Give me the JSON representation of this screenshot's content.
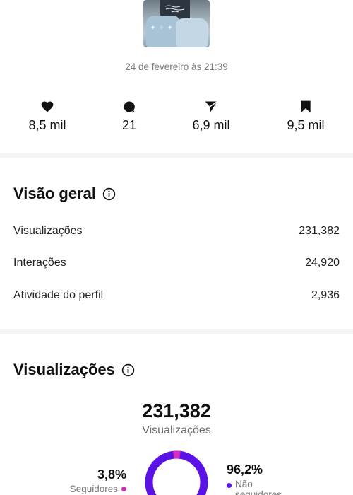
{
  "post": {
    "date": "24 de fevereiro às 21:39"
  },
  "stats": {
    "likes": "8,5 mil",
    "comments": "21",
    "shares": "6,9 mil",
    "saves": "9,5 mil"
  },
  "overview": {
    "title": "Visão geral",
    "rows": [
      {
        "label": "Visualizações",
        "value": "231,382"
      },
      {
        "label": "Interações",
        "value": "24,920"
      },
      {
        "label": "Atividade do perfil",
        "value": "2,936"
      }
    ]
  },
  "views": {
    "title": "Visualizações",
    "total": "231,382",
    "total_label": "Visualizações",
    "followers": {
      "percent": "3,8%",
      "label": "Seguidores",
      "fraction": 0.038,
      "color": "#d62fbf"
    },
    "non_followers": {
      "percent": "96,2%",
      "label": "Não seguidores",
      "fraction": 0.962,
      "color": "#5a12e6"
    }
  },
  "colors": {
    "text": "#111111",
    "muted": "#7a7a7a",
    "divider": "#f4f4f4"
  },
  "icons": {
    "likes": "heart-icon",
    "comments": "comment-icon",
    "shares": "send-icon",
    "saves": "bookmark-icon",
    "info": "info-icon"
  }
}
